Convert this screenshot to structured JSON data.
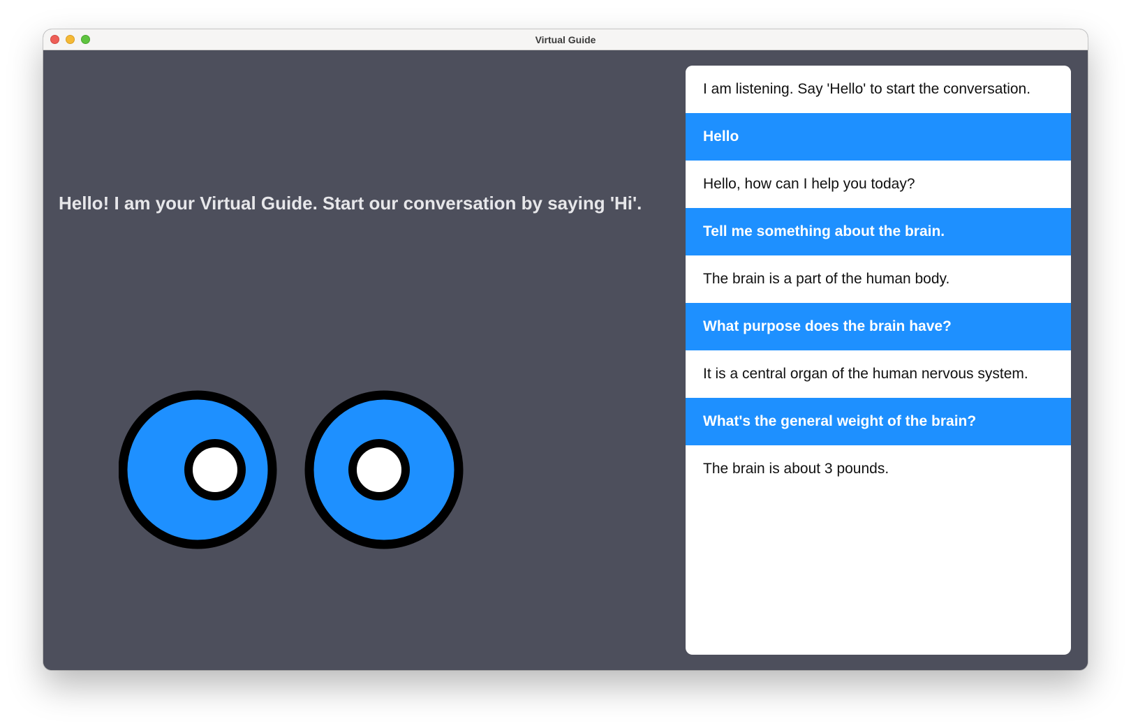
{
  "window": {
    "title": "Virtual Guide"
  },
  "main": {
    "greeting": "Hello! I am your Virtual Guide. Start our conversation by saying 'Hi'."
  },
  "colors": {
    "background": "#4d4f5c",
    "accent": "#1e90ff",
    "user_bubble_text": "#ffffff",
    "bot_bubble_bg": "#ffffff"
  },
  "chat": {
    "messages": [
      {
        "role": "bot",
        "text": "I am listening. Say 'Hello' to start the conversation."
      },
      {
        "role": "user",
        "text": "Hello"
      },
      {
        "role": "bot",
        "text": "Hello, how can I help you today?"
      },
      {
        "role": "user",
        "text": "Tell me something about the brain."
      },
      {
        "role": "bot",
        "text": "The brain is a part of the human body."
      },
      {
        "role": "user",
        "text": "What purpose does the brain have?"
      },
      {
        "role": "bot",
        "text": "It is a central organ of the human nervous system."
      },
      {
        "role": "user",
        "text": "What's the general weight of the brain?"
      },
      {
        "role": "bot",
        "text": "The brain is about 3 pounds."
      }
    ]
  },
  "eyes": {
    "icon": "cartoon-eyes-icon",
    "iris_color": "#1e90ff",
    "outline_color": "#000000",
    "pupil_color": "#ffffff"
  }
}
